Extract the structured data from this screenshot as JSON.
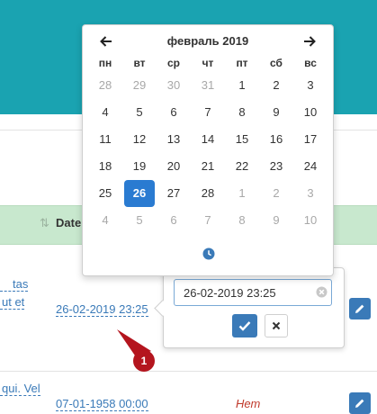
{
  "table": {
    "date_header": "Date",
    "rows": [
      {
        "text_line1": "tas",
        "text_line2": "ut et",
        "date": "26-02-2019 23:25"
      },
      {
        "text_line1": "qui. Vel",
        "date": "07-01-1958 00:00",
        "status": "Нет"
      }
    ]
  },
  "datepicker": {
    "month_title": "февраль 2019",
    "weekdays": [
      "пн",
      "вт",
      "ср",
      "чт",
      "пт",
      "сб",
      "вс"
    ],
    "weeks": [
      [
        "28",
        "29",
        "30",
        "31",
        "1",
        "2",
        "3"
      ],
      [
        "4",
        "5",
        "6",
        "7",
        "8",
        "9",
        "10"
      ],
      [
        "11",
        "12",
        "13",
        "14",
        "15",
        "16",
        "17"
      ],
      [
        "18",
        "19",
        "20",
        "21",
        "22",
        "23",
        "24"
      ],
      [
        "25",
        "26",
        "27",
        "28",
        "1",
        "2",
        "3"
      ],
      [
        "4",
        "5",
        "6",
        "7",
        "8",
        "9",
        "10"
      ]
    ],
    "selected_day": "26"
  },
  "editor": {
    "value": "26-02-2019 23:25"
  },
  "callout": {
    "number": "1"
  }
}
